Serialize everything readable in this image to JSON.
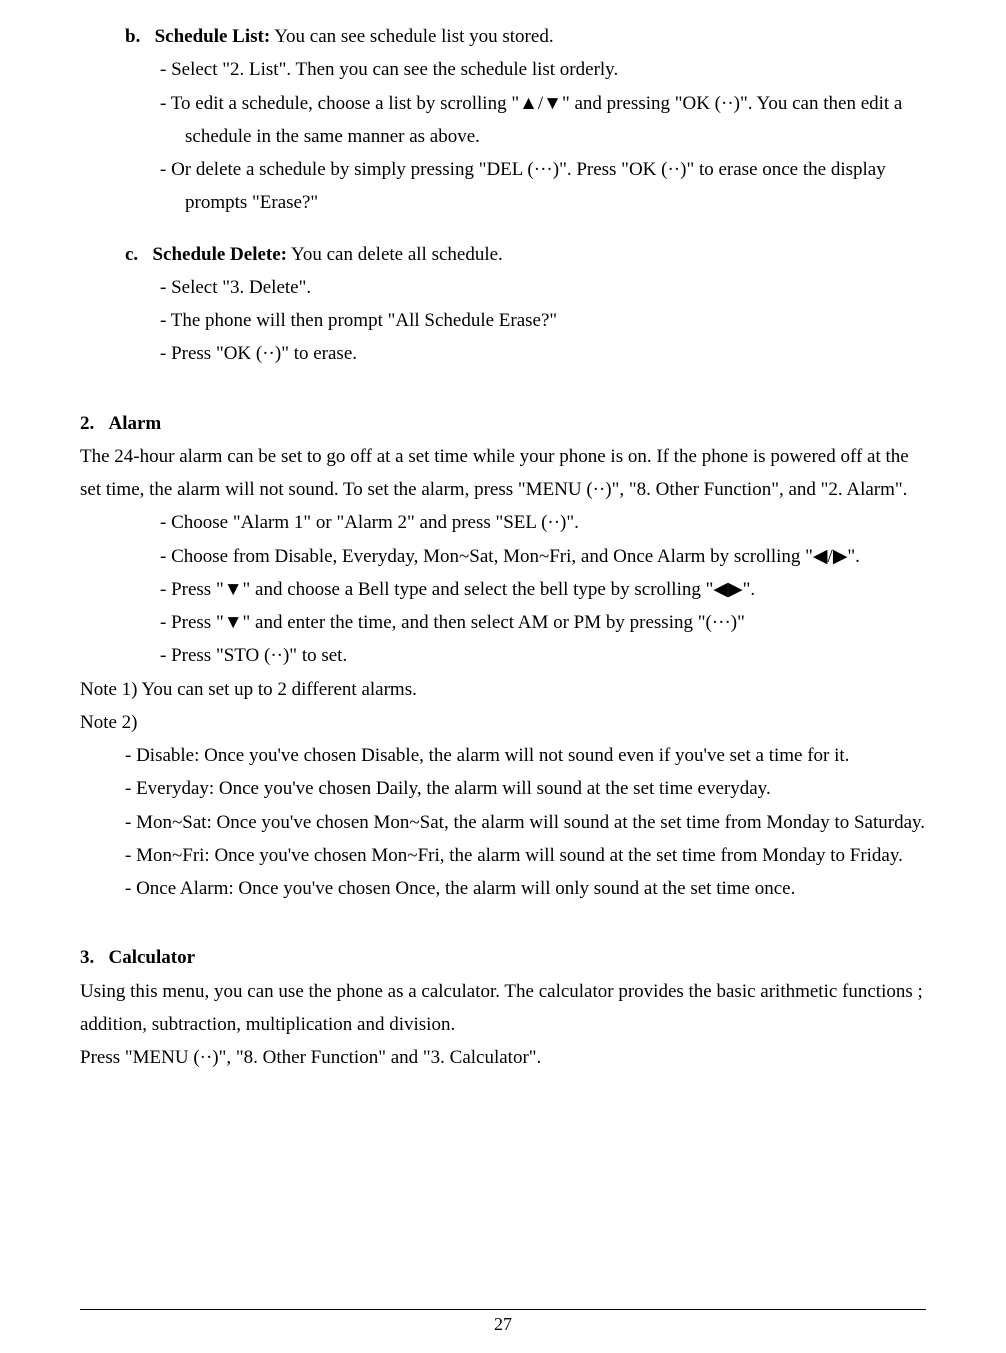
{
  "section_b": {
    "label": "b.",
    "title": "Schedule List:",
    "desc": " You can see schedule list you stored.",
    "items": [
      "Select \"2. List\". Then you can see the schedule list orderly.",
      "To edit a schedule, choose a list by scrolling \"▲/▼\" and pressing \"OK (··)\". You can then edit a schedule in the same manner as above.",
      "Or delete a schedule by simply pressing \"DEL (···)\".    Press \"OK (··)\" to erase once the display prompts \"Erase?\""
    ]
  },
  "section_c": {
    "label": "c.",
    "title": "Schedule Delete:",
    "desc": " You can delete all schedule.",
    "items": [
      "Select \"3. Delete\".",
      "The phone will then prompt \"All Schedule Erase?\"",
      "Press \"OK (··)\" to erase."
    ]
  },
  "section_2": {
    "label": "2.",
    "title": "Alarm",
    "intro": "The 24-hour alarm can be set to go off at a set time while your phone is on. If the phone is powered off at the set time, the alarm will not sound. To set the alarm, press \"MENU (··)\", \"8. Other Function\", and \"2. Alarm\".",
    "items": [
      "Choose \"Alarm 1\" or \"Alarm 2\" and press \"SEL (··)\".",
      "Choose from Disable, Everyday, Mon~Sat, Mon~Fri, and Once Alarm by scrolling \"◀/▶\".",
      "Press \"▼\" and choose a Bell type and select the bell type by scrolling \"◀▶\".",
      "Press \"▼\" and enter the time, and then select AM or PM by pressing \"(···)\"",
      "Press \"STO (··)\" to set."
    ],
    "note1": "Note 1) You can set up to 2 different alarms.",
    "note2_label": "Note 2)",
    "note2_items": [
      "Disable: Once you've chosen Disable, the alarm will not sound even if you've set a time for it.",
      "Everyday: Once you've chosen Daily, the alarm will sound at the set time everyday.",
      "Mon~Sat: Once you've chosen Mon~Sat, the alarm will sound at the set time from Monday to Saturday.",
      "Mon~Fri: Once you've chosen Mon~Fri, the alarm will sound at the set time from Monday to Friday.",
      "Once Alarm: Once you've chosen Once, the alarm will only sound at the set time once."
    ]
  },
  "section_3": {
    "label": "3.",
    "title": "Calculator",
    "p1": "Using this menu, you can use the phone as a calculator. The calculator provides the basic arithmetic functions ; addition, subtraction, multiplication and division.",
    "p2": "Press \"MENU (··)\", \"8. Other Function\" and \"3. Calculator\"."
  },
  "page_number": "27",
  "bullet": "-    "
}
